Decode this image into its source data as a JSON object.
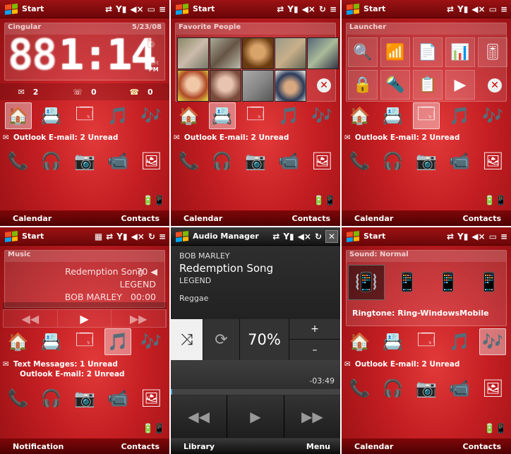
{
  "status": {
    "start": "Start",
    "audio_manager": "Audio Manager",
    "close_glyph": "✕"
  },
  "panel1": {
    "card_title": "Cingular",
    "date": "5/23/08",
    "time": "1:14",
    "ghost": "88",
    "am": "AM",
    "pm": "PM",
    "email_count": "2",
    "voicemail_count": "0",
    "missed_count": "0",
    "message": "Outlook E-mail: 2 Unread",
    "left_soft": "Calendar",
    "right_soft": "Contacts"
  },
  "panel2": {
    "card_title": "Favorite People",
    "message": "Outlook E-mail: 2 Unread",
    "left_soft": "Calendar",
    "right_soft": "Contacts"
  },
  "panel3": {
    "card_title": "Launcher",
    "message": "Outlook E-mail: 2 Unread",
    "left_soft": "Calendar",
    "right_soft": "Contacts"
  },
  "panel4": {
    "card_title": "Music",
    "song": "Redemption Song",
    "volume": "70",
    "album": "LEGEND",
    "artist": "BOB MARLEY",
    "elapsed": "00:00",
    "message1": "Text Messages: 1 Unread",
    "message2": "Outlook E-mail: 2 Unread",
    "left_soft": "Notification",
    "right_soft": "Contacts"
  },
  "panel5": {
    "artist": "BOB MARLEY",
    "song": "Redemption Song",
    "album": "LEGEND",
    "genre": "Reggae",
    "volume": "70%",
    "plus": "+",
    "minus": "–",
    "remaining": "-03:49",
    "progress": 0.01,
    "left_soft": "Library",
    "right_soft": "Menu"
  },
  "panel6": {
    "card_title": "Sound: Normal",
    "ringtone": "Ringtone: Ring-WindowsMobile",
    "message": "Outlook E-mail: 2 Unread",
    "left_soft": "Calendar",
    "right_soft": "Contacts"
  },
  "colors": {
    "accent": "#c51f23",
    "dark": "#2a2a2a"
  }
}
